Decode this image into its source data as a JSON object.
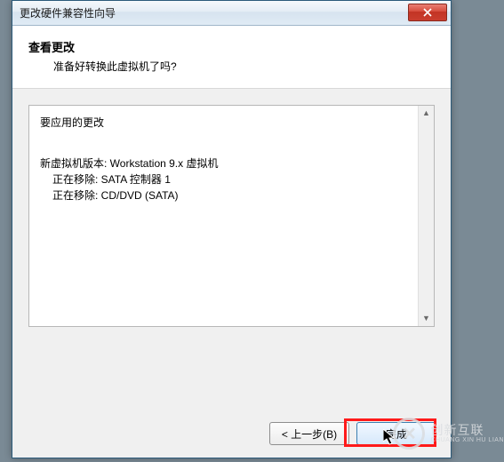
{
  "titlebar": {
    "text": "更改硬件兼容性向导"
  },
  "header": {
    "title": "查看更改",
    "subtitle": "准备好转换此虚拟机了吗?"
  },
  "changes": {
    "label": "要应用的更改",
    "version": "新虚拟机版本: Workstation 9.x 虚拟机",
    "remove1": "正在移除: SATA 控制器 1",
    "remove2": "正在移除: CD/DVD (SATA)"
  },
  "buttons": {
    "back": "< 上一步(B)",
    "finish": "完成"
  },
  "watermark": {
    "cn": "创新互联",
    "py": "CHUANG XIN HU LIAN"
  }
}
